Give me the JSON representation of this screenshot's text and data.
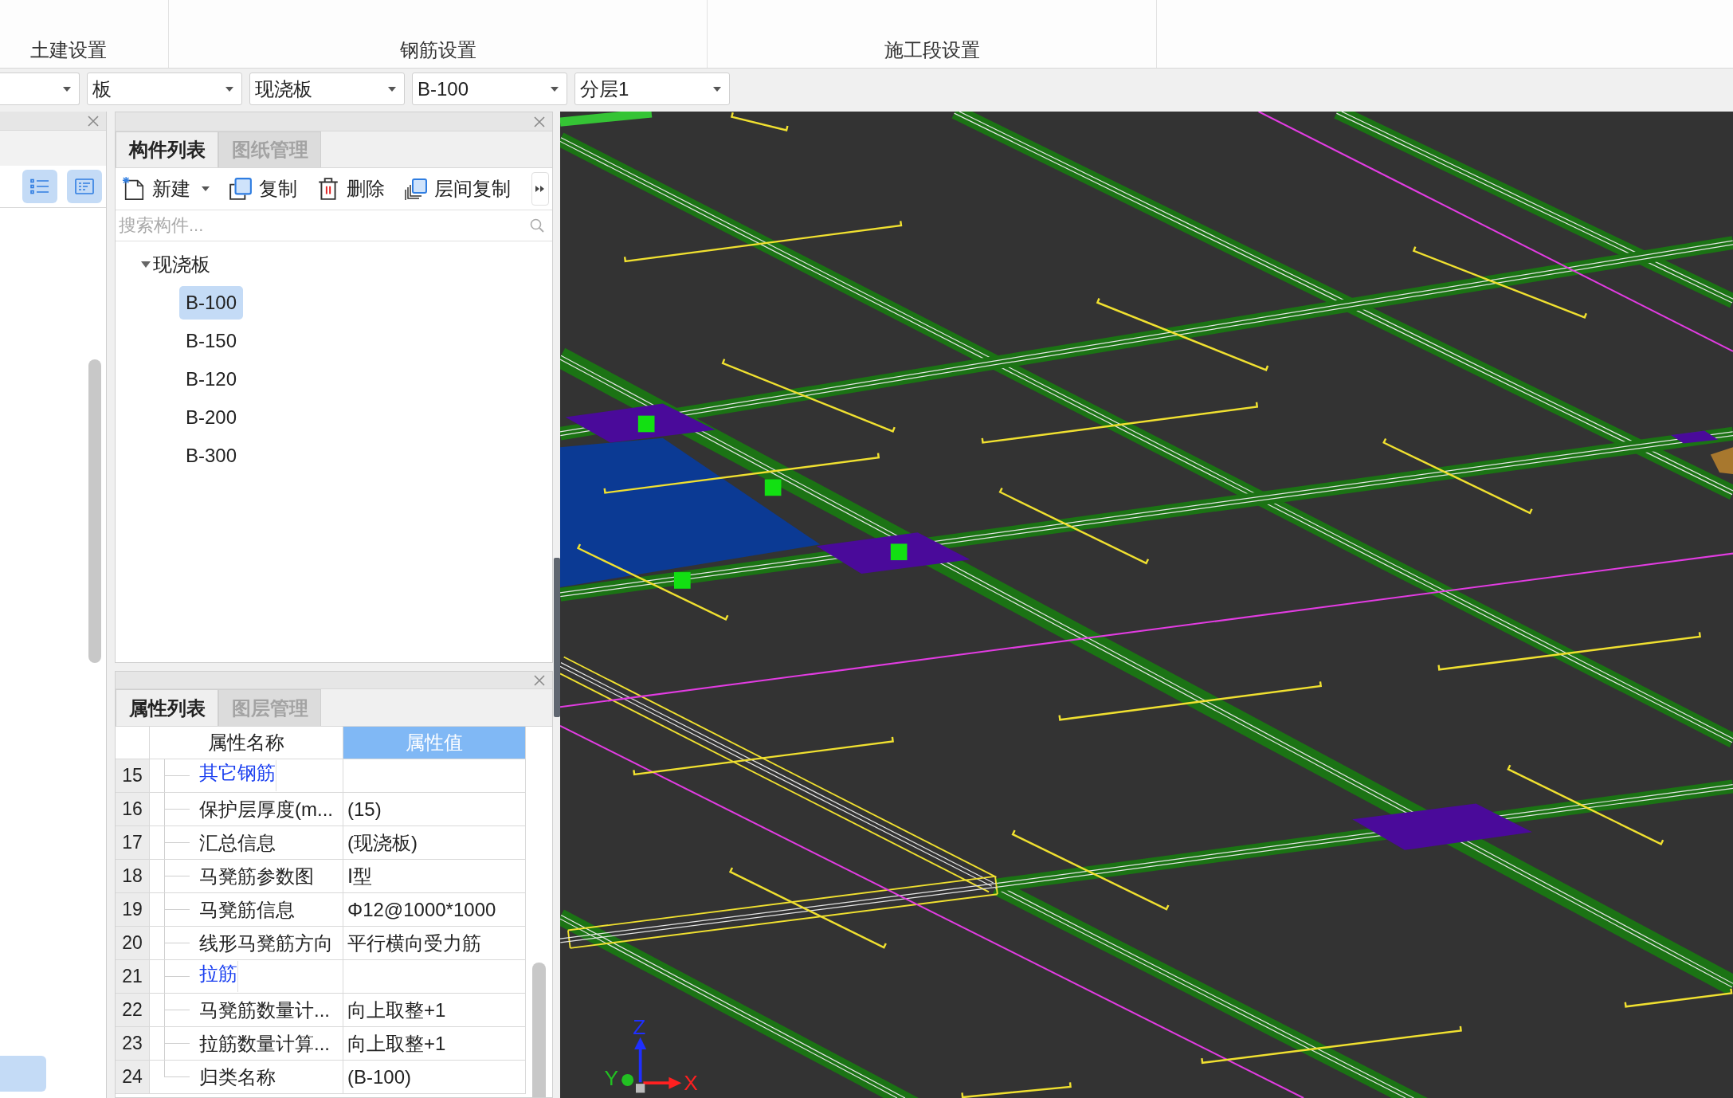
{
  "ribbon": {
    "groups": [
      {
        "label": "土建设置"
      },
      {
        "label": "钢筋设置"
      },
      {
        "label": "施工段设置"
      }
    ]
  },
  "selectors": [
    {
      "clipped": true
    },
    {
      "value": "板",
      "clipped": false
    },
    {
      "value": "现浇板",
      "clipped": false
    },
    {
      "value": "B-100",
      "clipped": false
    },
    {
      "value": "分层1",
      "clipped": false
    }
  ],
  "left_panel": {
    "view_buttons": [
      {
        "kind": "bullet-list"
      },
      {
        "kind": "detail-list"
      }
    ],
    "selection_highlight": true
  },
  "component_panel": {
    "tabs": [
      {
        "label": "构件列表",
        "selected": true
      },
      {
        "label": "图纸管理",
        "selected": false
      }
    ],
    "toolbar": [
      {
        "kind": "new",
        "label": "新建",
        "has_menu": true
      },
      {
        "kind": "copy",
        "label": "复制",
        "has_menu": false
      },
      {
        "kind": "delete",
        "label": "删除",
        "has_menu": false
      },
      {
        "kind": "floor-copy",
        "label": "层间复制",
        "has_menu": false
      }
    ],
    "search": {
      "placeholder": "搜索构件..."
    },
    "tree": [
      {
        "label": "现浇板",
        "expanded": true,
        "children": [
          {
            "label": "B-100",
            "selected": true
          },
          {
            "label": "B-150",
            "selected": false
          },
          {
            "label": "B-120",
            "selected": false
          },
          {
            "label": "B-200",
            "selected": false
          },
          {
            "label": "B-300",
            "selected": false
          }
        ]
      }
    ]
  },
  "property_panel": {
    "tabs": [
      {
        "label": "属性列表",
        "selected": true
      },
      {
        "label": "图层管理",
        "selected": false
      }
    ],
    "columns": [
      {
        "label": "属性名称",
        "selected": false
      },
      {
        "label": "属性值",
        "selected": true
      }
    ],
    "rows": [
      {
        "number": "15",
        "kind": "group",
        "name": "其它钢筋"
      },
      {
        "number": "16",
        "kind": "property",
        "name": "保护层厚度(m...",
        "value": "(15)"
      },
      {
        "number": "17",
        "kind": "property",
        "name": "汇总信息",
        "value": "(现浇板)"
      },
      {
        "number": "18",
        "kind": "property",
        "name": "马凳筋参数图",
        "value": "Ⅰ型"
      },
      {
        "number": "19",
        "kind": "property",
        "name": "马凳筋信息",
        "value": "Φ12@1000*1000"
      },
      {
        "number": "20",
        "kind": "property",
        "name": "线形马凳筋方向",
        "value": "平行横向受力筋"
      },
      {
        "number": "21",
        "kind": "group",
        "name": "拉筋"
      },
      {
        "number": "22",
        "kind": "property",
        "name": "马凳筋数量计...",
        "value": "向上取整+1"
      },
      {
        "number": "23",
        "kind": "property",
        "name": "拉筋数量计算...",
        "value": "向上取整+1"
      },
      {
        "number": "24",
        "kind": "property",
        "name": "归类名称",
        "value": "(B-100)"
      }
    ]
  },
  "viewport": {
    "axis_labels": {
      "x": "X",
      "y": "Y",
      "z": "Z"
    }
  }
}
